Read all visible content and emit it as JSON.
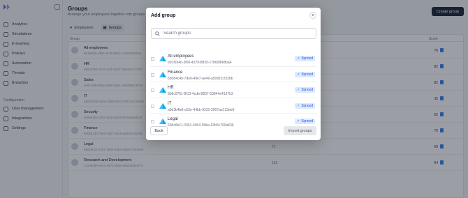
{
  "sidebar": {
    "items": [
      {
        "label": "Analytics",
        "icon": "chart-icon"
      },
      {
        "label": "Simulations",
        "icon": "simulation-icon"
      },
      {
        "label": "E-learning",
        "icon": "graduation-icon"
      },
      {
        "label": "Policies",
        "icon": "document-icon"
      },
      {
        "label": "Automation",
        "icon": "automation-icon"
      },
      {
        "label": "Threats",
        "icon": "threat-icon"
      },
      {
        "label": "Breaches",
        "icon": "breach-icon"
      }
    ],
    "config_label": "Configuration",
    "config_items": [
      {
        "label": "User management",
        "icon": "users-icon"
      },
      {
        "label": "Integrations",
        "icon": "plug-icon"
      },
      {
        "label": "Settings",
        "icon": "gear-icon"
      }
    ]
  },
  "page": {
    "title": "Groups",
    "subtitle": "Arrange your employees together into groups",
    "create_label": "Create group",
    "tabs": [
      "Employees",
      "Groups"
    ],
    "col_group": "Group",
    "col_score": "Score"
  },
  "bg_rows": [
    {
      "name": "All employees",
      "id": "901f934b-3f60-4379-8820-17860f868ba4",
      "num": "",
      "score": "76"
    },
    {
      "name": "HR",
      "id": "8b8c9751-8f13-4cdb-8837-53844e4137b3",
      "num": "",
      "score": "82"
    },
    {
      "name": "Sales",
      "id": "846c2ef8-8b5e-4b8e-bde1-a4b099d1903e",
      "num": "",
      "score": "82"
    },
    {
      "name": "IT",
      "id": "a9d3b4b8-c53e-44bb-9333-3907ae133eb9",
      "num": "",
      "score": "35"
    },
    {
      "name": "Security",
      "id": "4b8e53f4-c303-44a8-a634-90756a9ab53f",
      "num": "",
      "score": "62"
    },
    {
      "name": "Finance",
      "id": "650b4c4b-7de0-49e7-ae49-a5091fc252bb",
      "num": "",
      "score": "76"
    },
    {
      "name": "Legal",
      "id": "69dc8e11-0361-4904-90ba-63b5c790a636",
      "num": "71",
      "score": "69"
    },
    {
      "name": "Research and Development",
      "id": "c2190d8e-e6c6-4972-88d6-88a01bbe4f70",
      "num": "123",
      "score": "64"
    }
  ],
  "modal": {
    "title": "Add group",
    "search_placeholder": "Search groups",
    "rows": [
      {
        "name": "All employees",
        "id": "901f934b-3f60-4379-8820-17860f868ba4",
        "status": "Synced"
      },
      {
        "name": "Finance",
        "id": "650b4c4b-7de0-49e7-ae49-a5091fc252bb",
        "status": "Synced"
      },
      {
        "name": "HR",
        "id": "8b8c9751-8f13-4cdb-8837-53844e4137b3",
        "status": "Synced"
      },
      {
        "name": "IT",
        "id": "a9d3b4b8-c53e-44bb-9333-3907ae133eb9",
        "status": "Synced"
      },
      {
        "name": "Legal",
        "id": "69dc8e11-0361-4904-90ba-63b5c790a636",
        "status": "Synced"
      }
    ],
    "back_label": "Back",
    "import_label": "Import groups"
  },
  "colors": {
    "accent": "#1f2937",
    "synced_bg": "#dbeafe",
    "synced_text": "#1d4ed8",
    "overlay": "#111827"
  }
}
